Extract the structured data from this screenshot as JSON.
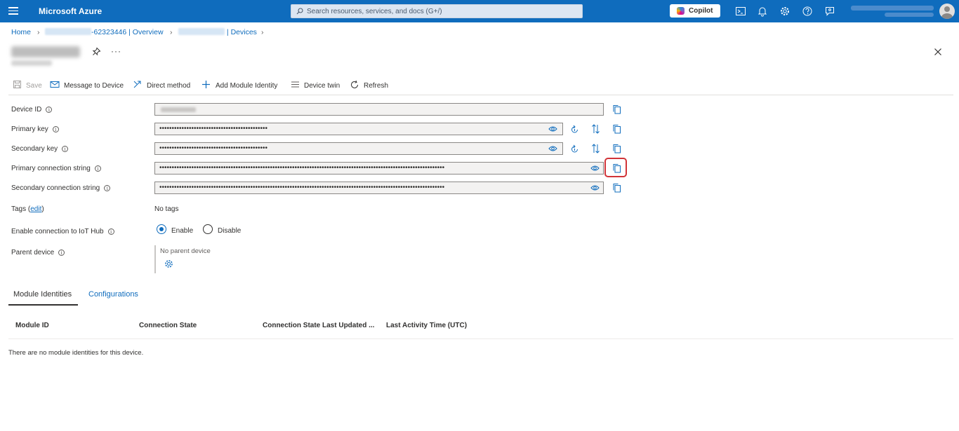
{
  "topbar": {
    "brand": "Microsoft Azure",
    "search_placeholder": "Search resources, services, and docs (G+/)",
    "copilot_label": "Copilot",
    "icons": [
      "cloud-shell-icon",
      "notifications-icon",
      "settings-icon",
      "help-icon",
      "feedback-icon"
    ],
    "accent_color": "#0f6cbd"
  },
  "breadcrumb": {
    "home": "Home",
    "hub_suffix": "-62323446 | Overview",
    "devices": "| Devices"
  },
  "commands": {
    "save": "Save",
    "message": "Message to Device",
    "direct_method": "Direct method",
    "add_module": "Add Module Identity",
    "device_twin": "Device twin",
    "refresh": "Refresh"
  },
  "form": {
    "device_id_label": "Device ID",
    "primary_key_label": "Primary key",
    "primary_key_value": "••••••••••••••••••••••••••••••••••••••••••••",
    "secondary_key_label": "Secondary key",
    "secondary_key_value": "••••••••••••••••••••••••••••••••••••••••••••",
    "primary_conn_label": "Primary connection string",
    "primary_conn_value": "••••••••••••••••••••••••••••••••••••••••••••••••••••••••••••••••••••••••••••••••••••••••••••••••••••••••••••••••••••",
    "secondary_conn_label": "Secondary connection string",
    "secondary_conn_value": "••••••••••••••••••••••••••••••••••••••••••••••••••••••••••••••••••••••••••••••••••••••••••••••••••••••••••••••••••••",
    "tags_label": "Tags (",
    "tags_edit": "edit",
    "tags_close": ")",
    "tags_value": "No tags",
    "enable_label": "Enable connection to IoT Hub",
    "enable_option": "Enable",
    "disable_option": "Disable",
    "enabled": true,
    "parent_label": "Parent device",
    "parent_value": "No parent device"
  },
  "tabs": {
    "module_identities": "Module Identities",
    "configurations": "Configurations"
  },
  "table": {
    "columns": [
      "Module ID",
      "Connection State",
      "Connection State Last Updated ...",
      "Last Activity Time (UTC)"
    ],
    "empty_message": "There are no module identities for this device."
  },
  "highlight_color": "#d13438"
}
